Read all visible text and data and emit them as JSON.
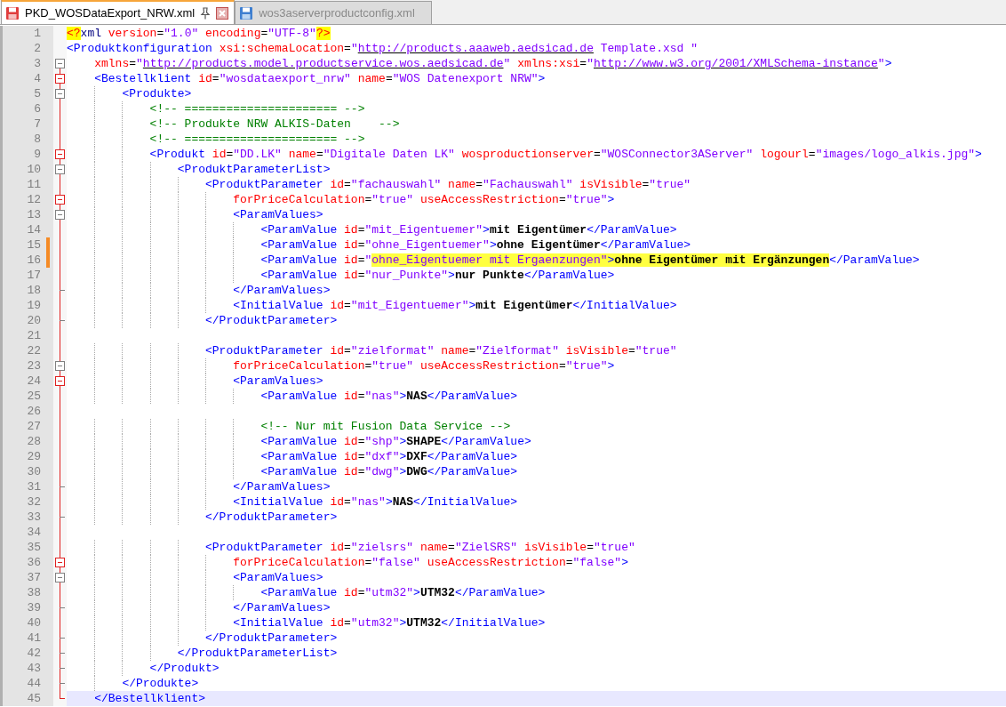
{
  "tabs": [
    {
      "label": "PKD_WOSDataExport_NRW.xml",
      "selected": true,
      "unsaved": true,
      "pinned": true,
      "closable": true
    },
    {
      "label": "wos3aserverproductconfig.xml",
      "selected": false,
      "unsaved": false,
      "pinned": false,
      "closable": false
    }
  ],
  "lines": [
    {
      "n": "1",
      "changed": false,
      "current": false,
      "tokens": [
        {
          "kind": "pi",
          "t": "<?"
        },
        {
          "kind": "pi-name",
          "t": "xml"
        },
        {
          "kind": "attr",
          "t": " version"
        },
        {
          "kind": "eq",
          "t": "="
        },
        {
          "kind": "value",
          "t": "\"1.0\""
        },
        {
          "kind": "attr",
          "t": " encoding"
        },
        {
          "kind": "eq",
          "t": "="
        },
        {
          "kind": "value",
          "t": "\"UTF-8\""
        },
        {
          "kind": "pi",
          "t": "?>"
        }
      ]
    },
    {
      "n": "2",
      "changed": false,
      "current": false,
      "tokens": [
        {
          "kind": "tag",
          "t": "<Produktkonfiguration"
        },
        {
          "kind": "attr",
          "t": " xsi:schemaLocation"
        },
        {
          "kind": "eq",
          "t": "="
        },
        {
          "kind": "value",
          "t": "\""
        },
        {
          "kind": "link",
          "t": "http://products.aaaweb.aedsicad.de"
        },
        {
          "kind": "value",
          "t": " Template.xsd \""
        }
      ]
    },
    {
      "n": "3",
      "fold": {
        "kind": "top"
      },
      "changed": false,
      "current": false,
      "tokens": [
        {
          "kind": "attr",
          "t": "    xmlns"
        },
        {
          "kind": "eq",
          "t": "="
        },
        {
          "kind": "value",
          "t": "\""
        },
        {
          "kind": "link",
          "t": "http://products.model.productservice.wos.aedsicad.de"
        },
        {
          "kind": "value",
          "t": "\""
        },
        {
          "kind": "attr",
          "t": " xmlns:xsi"
        },
        {
          "kind": "eq",
          "t": "="
        },
        {
          "kind": "value",
          "t": "\""
        },
        {
          "kind": "link",
          "t": "http://www.w3.org/2001/XMLSchema-instance"
        },
        {
          "kind": "value",
          "t": "\""
        },
        {
          "kind": "tag",
          "t": ">"
        }
      ]
    },
    {
      "n": "4",
      "fold": {
        "kind": "box-red"
      },
      "changed": false,
      "current": false,
      "tokens": [
        {
          "kind": "tag",
          "t": "    <Bestellklient"
        },
        {
          "kind": "attr",
          "t": " id"
        },
        {
          "kind": "eq",
          "t": "="
        },
        {
          "kind": "value",
          "t": "\"wosdataexport_nrw\""
        },
        {
          "kind": "attr",
          "t": " name"
        },
        {
          "kind": "eq",
          "t": "="
        },
        {
          "kind": "value",
          "t": "\"WOS Datenexport NRW\""
        },
        {
          "kind": "tag",
          "t": ">"
        }
      ]
    },
    {
      "n": "5",
      "fold": {
        "kind": "box"
      },
      "changed": false,
      "current": false,
      "tokens": [
        {
          "kind": "tag",
          "t": "        <Produkte>"
        }
      ]
    },
    {
      "n": "6",
      "fold": {
        "kind": "line"
      },
      "changed": false,
      "current": false,
      "tokens": [
        {
          "kind": "comment",
          "t": "            <!-- ====================== -->"
        }
      ]
    },
    {
      "n": "7",
      "fold": {
        "kind": "line"
      },
      "changed": false,
      "current": false,
      "tokens": [
        {
          "kind": "comment",
          "t": "            <!-- Produkte NRW ALKIS-Daten    -->"
        }
      ]
    },
    {
      "n": "8",
      "fold": {
        "kind": "line"
      },
      "changed": false,
      "current": false,
      "tokens": [
        {
          "kind": "comment",
          "t": "            <!-- ====================== -->"
        }
      ]
    },
    {
      "n": "9",
      "fold": {
        "kind": "box-red"
      },
      "changed": false,
      "current": false,
      "tokens": [
        {
          "kind": "tag",
          "t": "            <Produkt"
        },
        {
          "kind": "attr",
          "t": " id"
        },
        {
          "kind": "eq",
          "t": "="
        },
        {
          "kind": "value",
          "t": "\"DD.LK\""
        },
        {
          "kind": "attr",
          "t": " name"
        },
        {
          "kind": "eq",
          "t": "="
        },
        {
          "kind": "value",
          "t": "\"Digitale Daten LK\""
        },
        {
          "kind": "attr",
          "t": " wosproductionserver"
        },
        {
          "kind": "eq",
          "t": "="
        },
        {
          "kind": "value",
          "t": "\"WOSConnector3AServer\""
        },
        {
          "kind": "attr",
          "t": " logourl"
        },
        {
          "kind": "eq",
          "t": "="
        },
        {
          "kind": "value",
          "t": "\"images/logo_alkis.jpg\""
        },
        {
          "kind": "tag",
          "t": ">"
        }
      ]
    },
    {
      "n": "10",
      "fold": {
        "kind": "box"
      },
      "changed": false,
      "current": false,
      "tokens": [
        {
          "kind": "tag",
          "t": "                <ProduktParameterList>"
        }
      ]
    },
    {
      "n": "11",
      "fold": {
        "kind": "line"
      },
      "changed": false,
      "current": false,
      "tokens": [
        {
          "kind": "tag",
          "t": "                    <ProduktParameter"
        },
        {
          "kind": "attr",
          "t": " id"
        },
        {
          "kind": "eq",
          "t": "="
        },
        {
          "kind": "value",
          "t": "\"fachauswahl\""
        },
        {
          "kind": "attr",
          "t": " name"
        },
        {
          "kind": "eq",
          "t": "="
        },
        {
          "kind": "value",
          "t": "\"Fachauswahl\""
        },
        {
          "kind": "attr",
          "t": " isVisible"
        },
        {
          "kind": "eq",
          "t": "="
        },
        {
          "kind": "value",
          "t": "\"true\""
        }
      ]
    },
    {
      "n": "12",
      "fold": {
        "kind": "box-red"
      },
      "changed": false,
      "current": false,
      "tokens": [
        {
          "kind": "attr",
          "t": "                        forPriceCalculation"
        },
        {
          "kind": "eq",
          "t": "="
        },
        {
          "kind": "value",
          "t": "\"true\""
        },
        {
          "kind": "attr",
          "t": " useAccessRestriction"
        },
        {
          "kind": "eq",
          "t": "="
        },
        {
          "kind": "value",
          "t": "\"true\""
        },
        {
          "kind": "tag",
          "t": ">"
        }
      ]
    },
    {
      "n": "13",
      "fold": {
        "kind": "box"
      },
      "changed": false,
      "current": false,
      "tokens": [
        {
          "kind": "tag",
          "t": "                        <ParamValues>"
        }
      ]
    },
    {
      "n": "14",
      "fold": {
        "kind": "line"
      },
      "changed": false,
      "current": false,
      "tokens": [
        {
          "kind": "tag",
          "t": "                            <ParamValue"
        },
        {
          "kind": "attr",
          "t": " id"
        },
        {
          "kind": "eq",
          "t": "="
        },
        {
          "kind": "value",
          "t": "\"mit_Eigentuemer\""
        },
        {
          "kind": "tag",
          "t": ">"
        },
        {
          "kind": "text",
          "t": "mit Eigentümer"
        },
        {
          "kind": "tag",
          "t": "</ParamValue>"
        }
      ]
    },
    {
      "n": "15",
      "fold": {
        "kind": "line"
      },
      "changed": true,
      "current": false,
      "tokens": [
        {
          "kind": "tag",
          "t": "                            <ParamValue"
        },
        {
          "kind": "attr",
          "t": " id"
        },
        {
          "kind": "eq",
          "t": "="
        },
        {
          "kind": "value",
          "t": "\"ohne_Eigentuemer\""
        },
        {
          "kind": "tag",
          "t": ">"
        },
        {
          "kind": "text",
          "t": "ohne Eigentümer"
        },
        {
          "kind": "tag",
          "t": "</ParamValue>"
        }
      ]
    },
    {
      "n": "16",
      "fold": {
        "kind": "line"
      },
      "changed": true,
      "current": false,
      "tokens": [
        {
          "kind": "tag",
          "t": "                            <ParamValue"
        },
        {
          "kind": "attr",
          "t": " id"
        },
        {
          "kind": "eq",
          "t": "="
        },
        {
          "kind": "value",
          "t": "\""
        },
        {
          "kind": "value-hl",
          "t": "ohne_Eigentuemer mit Ergaenzungen\""
        },
        {
          "kind": "tag-hl",
          "t": ">"
        },
        {
          "kind": "text-hl",
          "t": "ohne Eigentümer mit Ergänzungen"
        },
        {
          "kind": "tag",
          "t": "</ParamValue>"
        }
      ]
    },
    {
      "n": "17",
      "fold": {
        "kind": "line"
      },
      "changed": false,
      "current": false,
      "tokens": [
        {
          "kind": "tag",
          "t": "                            <ParamValue"
        },
        {
          "kind": "attr",
          "t": " id"
        },
        {
          "kind": "eq",
          "t": "="
        },
        {
          "kind": "value",
          "t": "\"nur_Punkte\""
        },
        {
          "kind": "tag",
          "t": ">"
        },
        {
          "kind": "text",
          "t": "nur Punkte"
        },
        {
          "kind": "tag",
          "t": "</ParamValue>"
        }
      ]
    },
    {
      "n": "18",
      "fold": {
        "kind": "end"
      },
      "changed": false,
      "current": false,
      "tokens": [
        {
          "kind": "tag",
          "t": "                        </ParamValues>"
        }
      ]
    },
    {
      "n": "19",
      "fold": {
        "kind": "line"
      },
      "changed": false,
      "current": false,
      "tokens": [
        {
          "kind": "tag",
          "t": "                        <InitialValue"
        },
        {
          "kind": "attr",
          "t": " id"
        },
        {
          "kind": "eq",
          "t": "="
        },
        {
          "kind": "value",
          "t": "\"mit_Eigentuemer\""
        },
        {
          "kind": "tag",
          "t": ">"
        },
        {
          "kind": "text",
          "t": "mit Eigentümer"
        },
        {
          "kind": "tag",
          "t": "</InitialValue>"
        }
      ]
    },
    {
      "n": "20",
      "fold": {
        "kind": "end"
      },
      "changed": false,
      "current": false,
      "tokens": [
        {
          "kind": "tag",
          "t": "                    </ProduktParameter>"
        }
      ]
    },
    {
      "n": "21",
      "fold": {
        "kind": "line"
      },
      "changed": false,
      "current": false
    },
    {
      "n": "22",
      "fold": {
        "kind": "line"
      },
      "changed": false,
      "current": false,
      "tokens": [
        {
          "kind": "tag",
          "t": "                    <ProduktParameter"
        },
        {
          "kind": "attr",
          "t": " id"
        },
        {
          "kind": "eq",
          "t": "="
        },
        {
          "kind": "value",
          "t": "\"zielformat\""
        },
        {
          "kind": "attr",
          "t": " name"
        },
        {
          "kind": "eq",
          "t": "="
        },
        {
          "kind": "value",
          "t": "\"Zielformat\""
        },
        {
          "kind": "attr",
          "t": " isVisible"
        },
        {
          "kind": "eq",
          "t": "="
        },
        {
          "kind": "value",
          "t": "\"true\""
        }
      ]
    },
    {
      "n": "23",
      "fold": {
        "kind": "box"
      },
      "changed": false,
      "current": false,
      "tokens": [
        {
          "kind": "attr",
          "t": "                        forPriceCalculation"
        },
        {
          "kind": "eq",
          "t": "="
        },
        {
          "kind": "value",
          "t": "\"true\""
        },
        {
          "kind": "attr",
          "t": " useAccessRestriction"
        },
        {
          "kind": "eq",
          "t": "="
        },
        {
          "kind": "value",
          "t": "\"true\""
        },
        {
          "kind": "tag",
          "t": ">"
        }
      ]
    },
    {
      "n": "24",
      "fold": {
        "kind": "box-red"
      },
      "changed": false,
      "current": false,
      "tokens": [
        {
          "kind": "tag",
          "t": "                        <ParamValues>"
        }
      ]
    },
    {
      "n": "25",
      "fold": {
        "kind": "line"
      },
      "changed": false,
      "current": false,
      "tokens": [
        {
          "kind": "tag",
          "t": "                            <ParamValue"
        },
        {
          "kind": "attr",
          "t": " id"
        },
        {
          "kind": "eq",
          "t": "="
        },
        {
          "kind": "value",
          "t": "\"nas\""
        },
        {
          "kind": "tag",
          "t": ">"
        },
        {
          "kind": "text",
          "t": "NAS"
        },
        {
          "kind": "tag",
          "t": "</ParamValue>"
        }
      ]
    },
    {
      "n": "26",
      "fold": {
        "kind": "line"
      },
      "changed": false,
      "current": false
    },
    {
      "n": "27",
      "fold": {
        "kind": "line"
      },
      "changed": false,
      "current": false,
      "tokens": [
        {
          "kind": "comment",
          "t": "                            <!-- Nur mit Fusion Data Service -->"
        }
      ]
    },
    {
      "n": "28",
      "fold": {
        "kind": "line"
      },
      "changed": false,
      "current": false,
      "tokens": [
        {
          "kind": "tag",
          "t": "                            <ParamValue"
        },
        {
          "kind": "attr",
          "t": " id"
        },
        {
          "kind": "eq",
          "t": "="
        },
        {
          "kind": "value",
          "t": "\"shp\""
        },
        {
          "kind": "tag",
          "t": ">"
        },
        {
          "kind": "text",
          "t": "SHAPE"
        },
        {
          "kind": "tag",
          "t": "</ParamValue>"
        }
      ]
    },
    {
      "n": "29",
      "fold": {
        "kind": "line"
      },
      "changed": false,
      "current": false,
      "tokens": [
        {
          "kind": "tag",
          "t": "                            <ParamValue"
        },
        {
          "kind": "attr",
          "t": " id"
        },
        {
          "kind": "eq",
          "t": "="
        },
        {
          "kind": "value",
          "t": "\"dxf\""
        },
        {
          "kind": "tag",
          "t": ">"
        },
        {
          "kind": "text",
          "t": "DXF"
        },
        {
          "kind": "tag",
          "t": "</ParamValue>"
        }
      ]
    },
    {
      "n": "30",
      "fold": {
        "kind": "line"
      },
      "changed": false,
      "current": false,
      "tokens": [
        {
          "kind": "tag",
          "t": "                            <ParamValue"
        },
        {
          "kind": "attr",
          "t": " id"
        },
        {
          "kind": "eq",
          "t": "="
        },
        {
          "kind": "value",
          "t": "\"dwg\""
        },
        {
          "kind": "tag",
          "t": ">"
        },
        {
          "kind": "text",
          "t": "DWG"
        },
        {
          "kind": "tag",
          "t": "</ParamValue>"
        }
      ]
    },
    {
      "n": "31",
      "fold": {
        "kind": "end"
      },
      "changed": false,
      "current": false,
      "tokens": [
        {
          "kind": "tag",
          "t": "                        </ParamValues>"
        }
      ]
    },
    {
      "n": "32",
      "fold": {
        "kind": "line"
      },
      "changed": false,
      "current": false,
      "tokens": [
        {
          "kind": "tag",
          "t": "                        <InitialValue"
        },
        {
          "kind": "attr",
          "t": " id"
        },
        {
          "kind": "eq",
          "t": "="
        },
        {
          "kind": "value",
          "t": "\"nas\""
        },
        {
          "kind": "tag",
          "t": ">"
        },
        {
          "kind": "text",
          "t": "NAS"
        },
        {
          "kind": "tag",
          "t": "</InitialValue>"
        }
      ]
    },
    {
      "n": "33",
      "fold": {
        "kind": "end"
      },
      "changed": false,
      "current": false,
      "tokens": [
        {
          "kind": "tag",
          "t": "                    </ProduktParameter>"
        }
      ]
    },
    {
      "n": "34",
      "fold": {
        "kind": "line"
      },
      "changed": false,
      "current": false
    },
    {
      "n": "35",
      "fold": {
        "kind": "line"
      },
      "changed": false,
      "current": false,
      "tokens": [
        {
          "kind": "tag",
          "t": "                    <ProduktParameter"
        },
        {
          "kind": "attr",
          "t": " id"
        },
        {
          "kind": "eq",
          "t": "="
        },
        {
          "kind": "value",
          "t": "\"zielsrs\""
        },
        {
          "kind": "attr",
          "t": " name"
        },
        {
          "kind": "eq",
          "t": "="
        },
        {
          "kind": "value",
          "t": "\"ZielSRS\""
        },
        {
          "kind": "attr",
          "t": " isVisible"
        },
        {
          "kind": "eq",
          "t": "="
        },
        {
          "kind": "value",
          "t": "\"true\""
        }
      ]
    },
    {
      "n": "36",
      "fold": {
        "kind": "box-red"
      },
      "changed": false,
      "current": false,
      "tokens": [
        {
          "kind": "attr",
          "t": "                        forPriceCalculation"
        },
        {
          "kind": "eq",
          "t": "="
        },
        {
          "kind": "value",
          "t": "\"false\""
        },
        {
          "kind": "attr",
          "t": " useAccessRestriction"
        },
        {
          "kind": "eq",
          "t": "="
        },
        {
          "kind": "value",
          "t": "\"false\""
        },
        {
          "kind": "tag",
          "t": ">"
        }
      ]
    },
    {
      "n": "37",
      "fold": {
        "kind": "box"
      },
      "changed": false,
      "current": false,
      "tokens": [
        {
          "kind": "tag",
          "t": "                        <ParamValues>"
        }
      ]
    },
    {
      "n": "38",
      "fold": {
        "kind": "line"
      },
      "changed": false,
      "current": false,
      "tokens": [
        {
          "kind": "tag",
          "t": "                            <ParamValue"
        },
        {
          "kind": "attr",
          "t": " id"
        },
        {
          "kind": "eq",
          "t": "="
        },
        {
          "kind": "value",
          "t": "\"utm32\""
        },
        {
          "kind": "tag",
          "t": ">"
        },
        {
          "kind": "text",
          "t": "UTM32"
        },
        {
          "kind": "tag",
          "t": "</ParamValue>"
        }
      ]
    },
    {
      "n": "39",
      "fold": {
        "kind": "end"
      },
      "changed": false,
      "current": false,
      "tokens": [
        {
          "kind": "tag",
          "t": "                        </ParamValues>"
        }
      ]
    },
    {
      "n": "40",
      "fold": {
        "kind": "line"
      },
      "changed": false,
      "current": false,
      "tokens": [
        {
          "kind": "tag",
          "t": "                        <InitialValue"
        },
        {
          "kind": "attr",
          "t": " id"
        },
        {
          "kind": "eq",
          "t": "="
        },
        {
          "kind": "value",
          "t": "\"utm32\""
        },
        {
          "kind": "tag",
          "t": ">"
        },
        {
          "kind": "text",
          "t": "UTM32"
        },
        {
          "kind": "tag",
          "t": "</InitialValue>"
        }
      ]
    },
    {
      "n": "41",
      "fold": {
        "kind": "end"
      },
      "changed": false,
      "current": false,
      "tokens": [
        {
          "kind": "tag",
          "t": "                    </ProduktParameter>"
        }
      ]
    },
    {
      "n": "42",
      "fold": {
        "kind": "end"
      },
      "changed": false,
      "current": false,
      "tokens": [
        {
          "kind": "tag",
          "t": "                </ProduktParameterList>"
        }
      ]
    },
    {
      "n": "43",
      "fold": {
        "kind": "end"
      },
      "changed": false,
      "current": false,
      "tokens": [
        {
          "kind": "tag",
          "t": "            </Produkt>"
        }
      ]
    },
    {
      "n": "44",
      "fold": {
        "kind": "end"
      },
      "changed": false,
      "current": false,
      "tokens": [
        {
          "kind": "tag",
          "t": "        </Produkte>"
        }
      ]
    },
    {
      "n": "45",
      "fold": {
        "kind": "last"
      },
      "changed": false,
      "current": true,
      "tokens": [
        {
          "kind": "tag",
          "t": "    </Bestellklient>"
        }
      ]
    }
  ]
}
